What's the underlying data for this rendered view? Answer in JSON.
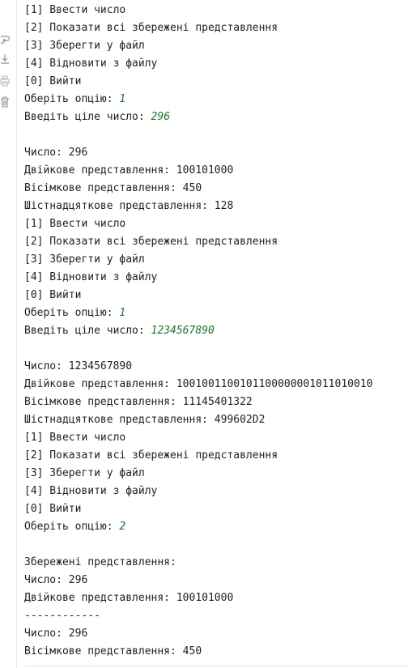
{
  "gutter": {
    "icons": [
      "wrap-icon",
      "download-icon",
      "print-icon",
      "trash-icon"
    ]
  },
  "console": {
    "lines": [
      {
        "text": "[1] Ввести число",
        "input": ""
      },
      {
        "text": "[2] Показати всі збережені представлення",
        "input": ""
      },
      {
        "text": "[3] Зберегти у файл",
        "input": ""
      },
      {
        "text": "[4] Відновити з файлу",
        "input": ""
      },
      {
        "text": "[0] Вийти",
        "input": ""
      },
      {
        "text": "Оберіть опцію: ",
        "input": "1"
      },
      {
        "text": "Введіть ціле число: ",
        "input": "296"
      },
      {
        "text": "",
        "input": ""
      },
      {
        "text": "Число: 296",
        "input": ""
      },
      {
        "text": "Двійкове представлення: 100101000",
        "input": ""
      },
      {
        "text": "Вісімкове представлення: 450",
        "input": ""
      },
      {
        "text": "Шістнадцяткове представлення: 128",
        "input": ""
      },
      {
        "text": "[1] Ввести число",
        "input": ""
      },
      {
        "text": "[2] Показати всі збережені представлення",
        "input": ""
      },
      {
        "text": "[3] Зберегти у файл",
        "input": ""
      },
      {
        "text": "[4] Відновити з файлу",
        "input": ""
      },
      {
        "text": "[0] Вийти",
        "input": ""
      },
      {
        "text": "Оберіть опцію: ",
        "input": "1"
      },
      {
        "text": "Введіть ціле число: ",
        "input": "1234567890"
      },
      {
        "text": "",
        "input": ""
      },
      {
        "text": "Число: 1234567890",
        "input": ""
      },
      {
        "text": "Двійкове представлення: 1001001100101100000001011010010",
        "input": ""
      },
      {
        "text": "Вісімкове представлення: 11145401322",
        "input": ""
      },
      {
        "text": "Шістнадцяткове представлення: 499602D2",
        "input": ""
      },
      {
        "text": "[1] Ввести число",
        "input": ""
      },
      {
        "text": "[2] Показати всі збережені представлення",
        "input": ""
      },
      {
        "text": "[3] Зберегти у файл",
        "input": ""
      },
      {
        "text": "[4] Відновити з файлу",
        "input": ""
      },
      {
        "text": "[0] Вийти",
        "input": ""
      },
      {
        "text": "Оберіть опцію: ",
        "input": "2"
      },
      {
        "text": "",
        "input": ""
      },
      {
        "text": "Збережені представлення:",
        "input": ""
      },
      {
        "text": "Число: 296",
        "input": ""
      },
      {
        "text": "Двійкове представлення: 100101000",
        "input": ""
      },
      {
        "text": "------------",
        "input": ""
      },
      {
        "text": "Число: 296",
        "input": ""
      },
      {
        "text": "Вісімкове представлення: 450",
        "input": ""
      }
    ]
  },
  "colors": {
    "text": "#1e1f22",
    "user_input": "#167c2a",
    "gutter_icon": "#8c8f96"
  }
}
